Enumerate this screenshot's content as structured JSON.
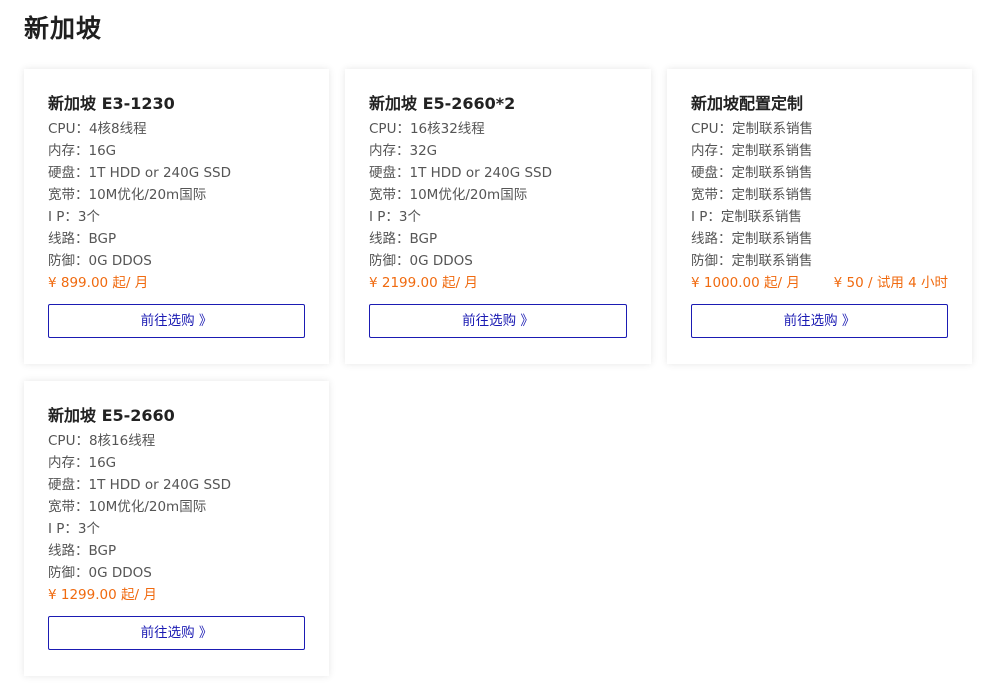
{
  "page": {
    "title": "新加坡"
  },
  "colors": {
    "price": "#f06a0f",
    "button": "#1b1bb3",
    "title": "#1f1f1f"
  },
  "products": [
    {
      "name": "新加坡 E3-1230",
      "specs": [
        "CPU：4核8线程",
        "内存：16G",
        "硬盘：1T HDD or 240G SSD",
        "宽带：10M优化/20m国际",
        "I P：3个",
        "线路：BGP",
        "防御：0G DDOS"
      ],
      "price": "¥ 899.00 起/ 月",
      "trial": "",
      "button_label": "前往选购 》"
    },
    {
      "name": "新加坡 E5-2660*2",
      "specs": [
        "CPU：16核32线程",
        "内存：32G",
        "硬盘：1T HDD or 240G SSD",
        "宽带：10M优化/20m国际",
        "I P：3个",
        "线路：BGP",
        "防御：0G DDOS"
      ],
      "price": "¥ 2199.00 起/ 月",
      "trial": "",
      "button_label": "前往选购 》"
    },
    {
      "name": "新加坡配置定制",
      "specs": [
        "CPU：定制联系销售",
        "内存：定制联系销售",
        "硬盘：定制联系销售",
        "宽带：定制联系销售",
        "I P：定制联系销售",
        "线路：定制联系销售",
        "防御：定制联系销售"
      ],
      "price": "¥ 1000.00 起/ 月",
      "trial": "¥ 50 / 试用 4 小时",
      "button_label": "前往选购 》"
    },
    {
      "name": "新加坡 E5-2660",
      "specs": [
        "CPU：8核16线程",
        "内存：16G",
        "硬盘：1T HDD or 240G SSD",
        "宽带：10M优化/20m国际",
        "I P：3个",
        "线路：BGP",
        "防御：0G DDOS"
      ],
      "price": "¥ 1299.00 起/ 月",
      "trial": "",
      "button_label": "前往选购 》"
    }
  ]
}
